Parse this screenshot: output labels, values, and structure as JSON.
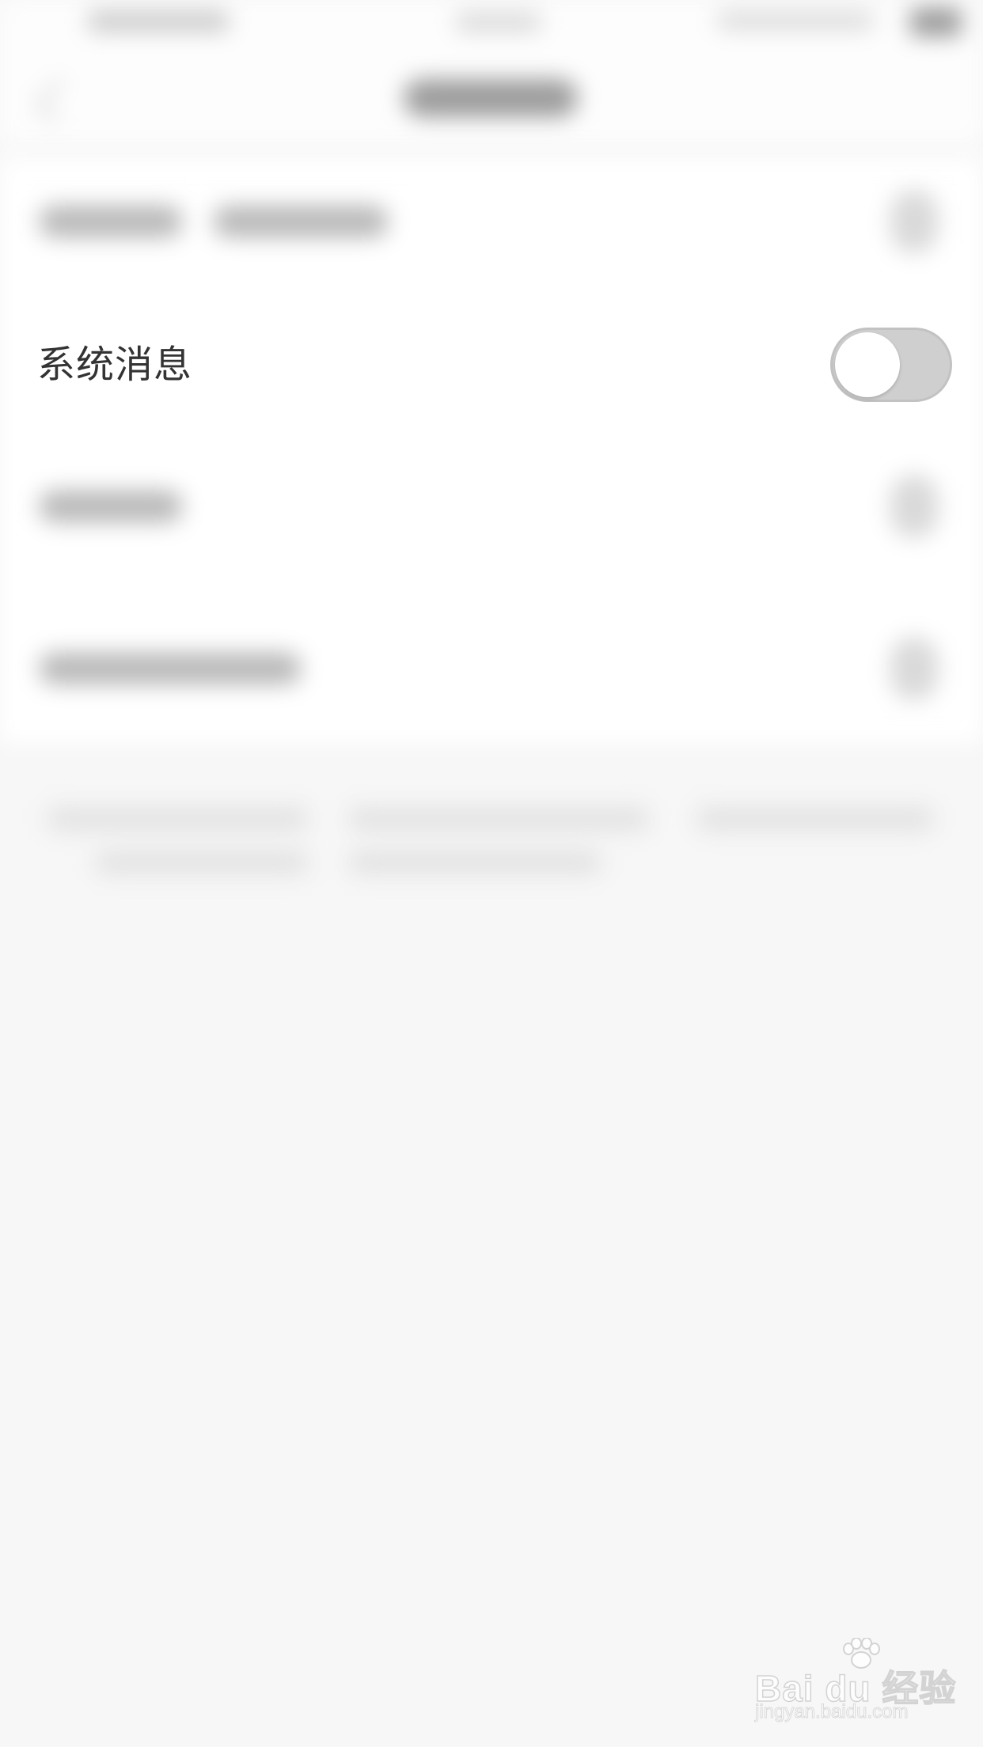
{
  "settings_row": {
    "label": "系统消息",
    "toggle_on": false
  },
  "watermark": {
    "brand": "Bai du 经验",
    "url": "jingyan.baidu.com"
  }
}
